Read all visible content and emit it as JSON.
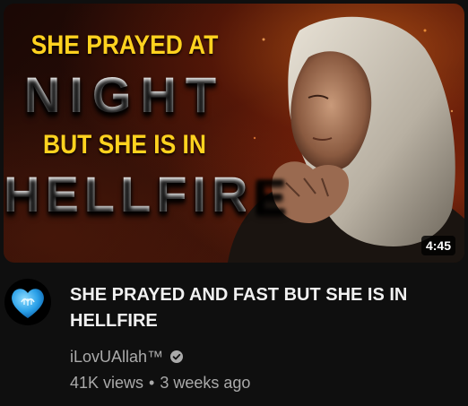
{
  "thumbnail": {
    "line1": "SHE PRAYED AT",
    "line2": "NIGHT",
    "line3": "BUT SHE IS IN",
    "line4": "HELLFIRE",
    "duration": "4:45"
  },
  "avatar": {
    "icon": "blue-heart-allah-calligraphy-icon"
  },
  "video": {
    "title": "SHE PRAYED AND FAST BUT SHE IS IN HELLFIRE",
    "channel": "iLovUAllah™",
    "views": "41K views",
    "separator": "•",
    "age": "3 weeks ago"
  },
  "colors": {
    "background": "#0f0f0f",
    "title_text": "#f1f1f1",
    "secondary_text": "#aaaaaa",
    "thumb_yellow": "#ffd21f",
    "avatar_blue": "#3ab0f0"
  }
}
